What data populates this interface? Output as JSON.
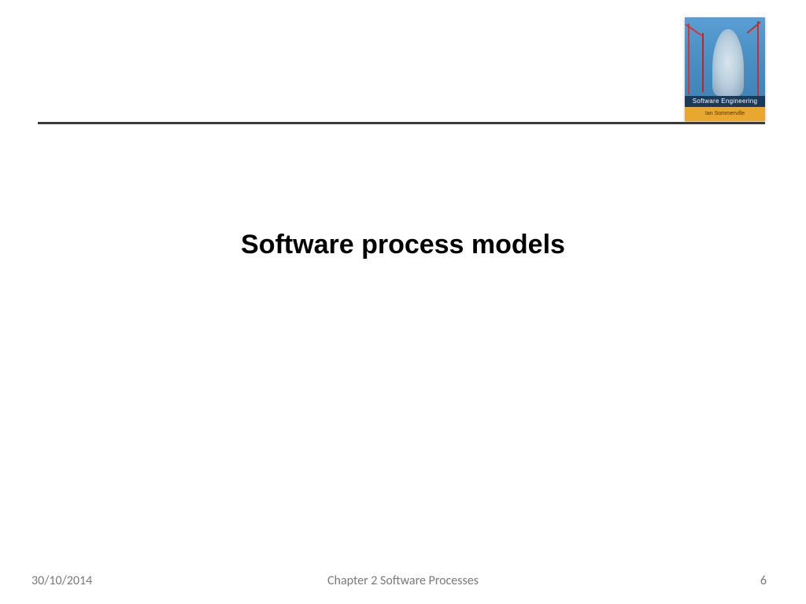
{
  "book_cover": {
    "title": "Software Engineering",
    "author": "Ian Sommerville"
  },
  "slide": {
    "title": "Software process models"
  },
  "footer": {
    "date": "30/10/2014",
    "chapter": "Chapter 2 Software Processes",
    "page_number": "6"
  }
}
